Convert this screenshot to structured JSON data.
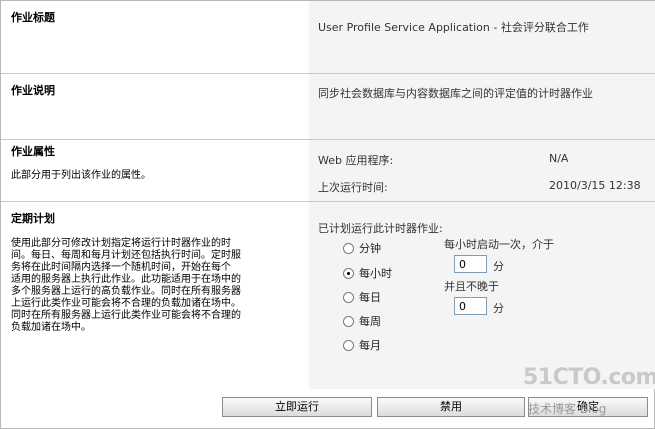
{
  "job_title": {
    "heading": "作业标题",
    "value": "User Profile Service Application - 社会评分联合工作"
  },
  "job_description": {
    "heading": "作业说明",
    "value": "同步社会数据库与内容数据库之间的评定值的计时器作业"
  },
  "job_properties": {
    "heading": "作业属性",
    "desc": "此部分用于列出该作业的属性。",
    "web_app_label": "Web 应用程序:",
    "web_app_value": "N/A",
    "last_run_label": "上次运行时间:",
    "last_run_value": "2010/3/15 12:38"
  },
  "schedule": {
    "heading": "定期计划",
    "desc_lines": [
      "使用此部分可修改计划指定将运行计时器作业的时",
      "间。每日、每周和每月计划还包括执行时间。定时服",
      "务将在此时间隔内选择一个随机时间，开始在每个",
      "适用的服务器上执行此作业。此功能适用于在场中的",
      "多个服务器上运行的高负载作业。同时在所有服务器",
      "上运行此类作业可能会将不合理的负载加诸在场中。",
      "同时在所有服务器上运行此类作业可能会将不合理的",
      "负载加诸在场中。"
    ],
    "prompt": "已计划运行此计时器作业:",
    "options": [
      "分钟",
      "每小时",
      "每日",
      "每周",
      "每月"
    ],
    "selected": "每小时",
    "hourly_start_label": "每小时启动一次，介于",
    "start_value": "0",
    "start_unit": "分",
    "not_later_label": "并且不晚于",
    "end_value": "0",
    "end_unit": "分"
  },
  "buttons": {
    "run_now": "立即运行",
    "disable": "禁用",
    "ok": "确定"
  },
  "watermark": {
    "line1": "51CTO.com",
    "line2": "技术博客 Blog"
  }
}
